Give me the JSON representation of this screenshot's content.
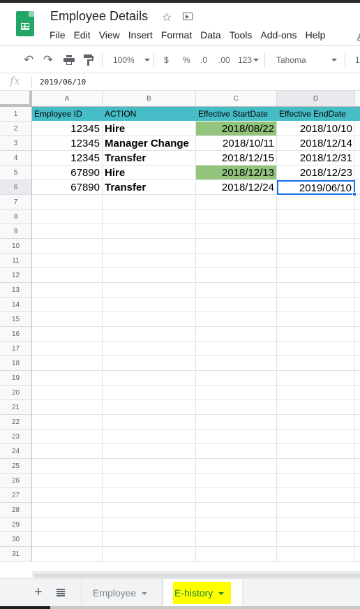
{
  "app": {
    "title": "Employee Details",
    "icons": {
      "logo": "sheets-logo-icon",
      "star": "star-icon",
      "move": "move-to-folder-icon"
    }
  },
  "menu": {
    "items": [
      "File",
      "Edit",
      "View",
      "Insert",
      "Format",
      "Data",
      "Tools",
      "Add-ons",
      "Help"
    ],
    "clipped_item": "A"
  },
  "toolbar": {
    "zoom": "100%",
    "currency": "$",
    "percent": "%",
    "decrease_decimal": ".0",
    "increase_decimal": ".00",
    "more_formats": "123",
    "font": "Tahoma",
    "font_size": "1"
  },
  "formula_bar": {
    "fx_label": "fx",
    "value": "2019/06/10"
  },
  "sheet": {
    "columns": [
      "A",
      "B",
      "C",
      "D"
    ],
    "row_numbers": [
      "1",
      "2",
      "3",
      "4",
      "5",
      "6",
      "7",
      "8",
      "9",
      "10",
      "11",
      "12",
      "13",
      "14",
      "15",
      "16",
      "17",
      "18",
      "19",
      "20",
      "21",
      "22",
      "23",
      "24",
      "25",
      "26",
      "27",
      "28",
      "29",
      "30",
      "31"
    ],
    "header_row": [
      "Employee ID",
      "ACTION",
      "Effective StartDate",
      "Effective EndDate"
    ],
    "rows": [
      [
        "12345",
        "Hire",
        "2018/08/22",
        "2018/10/10"
      ],
      [
        "12345",
        "Manager Change",
        "2018/10/11",
        "2018/12/14"
      ],
      [
        "12345",
        "Transfer",
        "2018/12/15",
        "2018/12/31"
      ],
      [
        "67890",
        "Hire",
        "2018/12/13",
        "2018/12/23"
      ],
      [
        "67890",
        "Transfer",
        "2018/12/24",
        "2019/06/10"
      ]
    ],
    "highlighted_cells": [
      "C2",
      "C5"
    ],
    "active_cell": "D6",
    "colors": {
      "header_fill": "#46bdc6",
      "highlight_fill": "#93c47d",
      "selection": "#1a73e8"
    }
  },
  "sheet_tabs": {
    "add_label": "+",
    "tabs": [
      {
        "label": "Employee",
        "active": false
      },
      {
        "label": "E-history",
        "active": true
      }
    ],
    "highlight_color": "#ffff00"
  }
}
